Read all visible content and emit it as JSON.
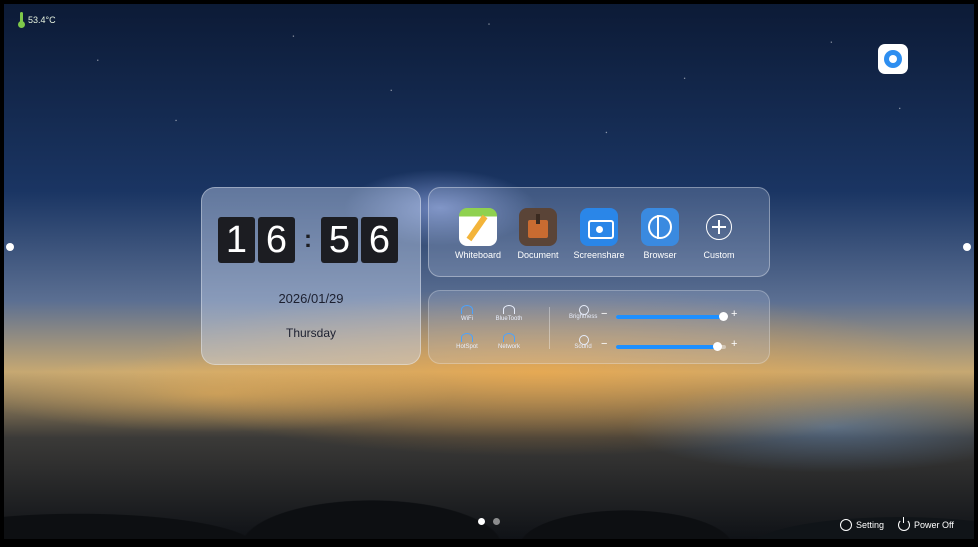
{
  "status": {
    "temperature": "53.4°C"
  },
  "clock": {
    "hour_tens": "1",
    "hour_ones": "6",
    "separator": ":",
    "minute_tens": "5",
    "minute_ones": "6",
    "date": "2026/01/29",
    "weekday": "Thursday"
  },
  "apps": [
    {
      "label": "Whiteboard",
      "icon": "whiteboard-icon"
    },
    {
      "label": "Document",
      "icon": "briefcase-icon"
    },
    {
      "label": "Screenshare",
      "icon": "screenshare-icon"
    },
    {
      "label": "Browser",
      "icon": "globe-icon"
    },
    {
      "label": "Custom",
      "icon": "plus-circle-icon"
    }
  ],
  "quick_settings": [
    {
      "label": "WiFi",
      "icon": "wifi-icon"
    },
    {
      "label": "BlueTooth",
      "icon": "bluetooth-icon"
    },
    {
      "label": "HotSpot",
      "icon": "hotspot-icon"
    },
    {
      "label": "Network",
      "icon": "network-icon"
    }
  ],
  "sliders": {
    "brightness": {
      "label": "Brightness",
      "minus": "−",
      "plus": "+",
      "level": 0.98
    },
    "sound": {
      "label": "Sound",
      "minus": "−",
      "plus": "+",
      "level": 0.93
    }
  },
  "footer": {
    "setting_label": "Setting",
    "power_label": "Power Off"
  },
  "pager": {
    "pages": 2,
    "active": 1
  },
  "colors": {
    "accent": "#1e90ff",
    "wifi_icon": "#4aa3ff",
    "thermometer": "#7ec84a"
  }
}
